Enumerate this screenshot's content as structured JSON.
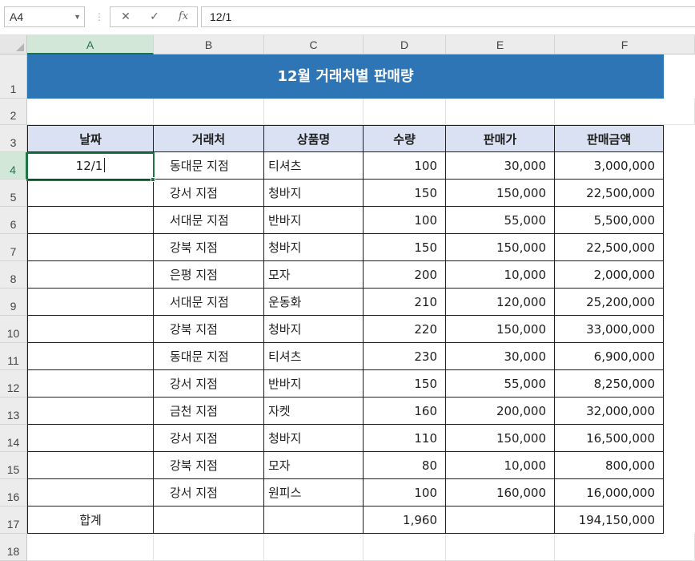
{
  "formula_bar": {
    "name_box": "A4",
    "cancel_icon": "✕",
    "enter_icon": "✓",
    "fx_label": "fx",
    "formula": "12/1"
  },
  "columns": [
    "A",
    "B",
    "C",
    "D",
    "E",
    "F"
  ],
  "rows": [
    "1",
    "2",
    "3",
    "4",
    "5",
    "6",
    "7",
    "8",
    "9",
    "10",
    "11",
    "12",
    "13",
    "14",
    "15",
    "16",
    "17",
    "18"
  ],
  "title": "12월 거래처별 판매량",
  "table": {
    "headers": [
      "날짜",
      "거래처",
      "상품명",
      "수량",
      "판매가",
      "판매금액"
    ],
    "rows": [
      [
        "12/1",
        "동대문 지점",
        "티셔츠",
        "100",
        "30,000",
        "3,000,000"
      ],
      [
        "",
        "강서 지점",
        "청바지",
        "150",
        "150,000",
        "22,500,000"
      ],
      [
        "",
        "서대문 지점",
        "반바지",
        "100",
        "55,000",
        "5,500,000"
      ],
      [
        "",
        "강북 지점",
        "청바지",
        "150",
        "150,000",
        "22,500,000"
      ],
      [
        "",
        "은평 지점",
        "모자",
        "200",
        "10,000",
        "2,000,000"
      ],
      [
        "",
        "서대문 지점",
        "운동화",
        "210",
        "120,000",
        "25,200,000"
      ],
      [
        "",
        "강북 지점",
        "청바지",
        "220",
        "150,000",
        "33,000,000"
      ],
      [
        "",
        "동대문 지점",
        "티셔츠",
        "230",
        "30,000",
        "6,900,000"
      ],
      [
        "",
        "강서 지점",
        "반바지",
        "150",
        "55,000",
        "8,250,000"
      ],
      [
        "",
        "금천 지점",
        "자켓",
        "160",
        "200,000",
        "32,000,000"
      ],
      [
        "",
        "강서  지점",
        "청바지",
        "110",
        "150,000",
        "16,500,000"
      ],
      [
        "",
        "강북 지점",
        "모자",
        "80",
        "10,000",
        "800,000"
      ],
      [
        "",
        "강서 지점",
        "원피스",
        "100",
        "160,000",
        "16,000,000"
      ]
    ],
    "total_row": [
      "합계",
      "",
      "",
      "1,960",
      "",
      "194,150,000"
    ]
  },
  "colors": {
    "title_fill": "#2e75b6",
    "header_fill": "#d9e1f2",
    "selection": "#217346"
  }
}
